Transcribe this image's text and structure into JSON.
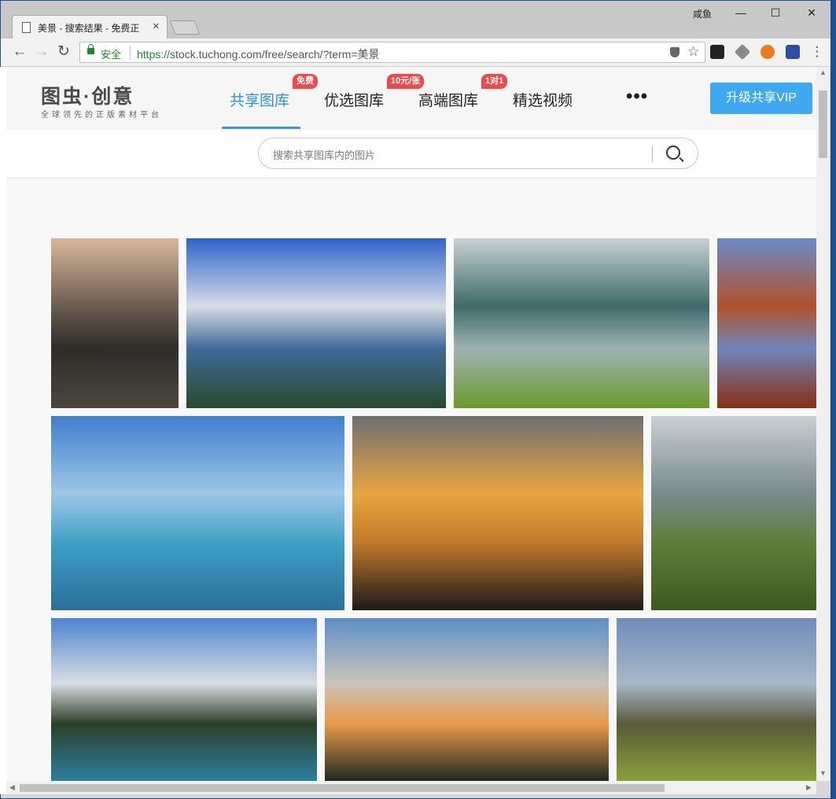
{
  "browser": {
    "tab_title": "美景 - 搜索结果 - 免费正",
    "tab_close": "×",
    "user": "咸鱼",
    "window_controls": {
      "minimize": "—",
      "maximize": "☐",
      "close": "✕"
    },
    "nav": {
      "back": "←",
      "forward": "→",
      "reload": "↻"
    },
    "secure_label": "安全",
    "url_protocol": "https://",
    "url_rest": "stock.tuchong.com/free/search/?term=美景",
    "star": "☆",
    "menu": "⋮"
  },
  "site": {
    "logo_mark": "图虫·创意",
    "logo_tagline": "全球领先的正版素材平台",
    "nav_items": [
      {
        "label": "共享图库",
        "badge": "免费",
        "active": true
      },
      {
        "label": "优选图库",
        "badge": "10元/张",
        "active": false
      },
      {
        "label": "高端图库",
        "badge": "1对1",
        "active": false
      },
      {
        "label": "精选视频",
        "badge": "",
        "active": false
      }
    ],
    "more": "•••",
    "vip_button": "升级共享VIP"
  },
  "search": {
    "placeholder": "搜索共享图库内的图片"
  },
  "results": {
    "images": [
      {
        "name": "sunset-lake-karst",
        "colors": [
          "#d9b79a",
          "#6b5d52",
          "#2f2c29",
          "#4b4640"
        ]
      },
      {
        "name": "mountain-clouds",
        "colors": [
          "#2f63c9",
          "#d6dce6",
          "#3f6a9a",
          "#284a2c"
        ]
      },
      {
        "name": "lake-shore-grass",
        "colors": [
          "#c8d2d4",
          "#3e6a6a",
          "#9fb3b3",
          "#6a9a2a"
        ]
      },
      {
        "name": "autumn-tree-reflection",
        "colors": [
          "#6a8cc8",
          "#b0522a",
          "#6f86b8",
          "#8a2e15"
        ]
      },
      {
        "name": "pier-blue-sea",
        "colors": [
          "#3f7fcf",
          "#9ec7e6",
          "#3fa0c6",
          "#2a6f9a"
        ]
      },
      {
        "name": "sunset-silhouette-trees",
        "colors": [
          "#6f6f72",
          "#e8a53f",
          "#c27a2c",
          "#1c1a19"
        ]
      },
      {
        "name": "yurt-grassland",
        "colors": [
          "#c9d0d3",
          "#7a8a8c",
          "#5f7e3a",
          "#3d5a20"
        ]
      },
      {
        "name": "alpine-lake-forest",
        "colors": [
          "#4c84d0",
          "#d8dde2",
          "#2c3f27",
          "#2b7fa0"
        ]
      },
      {
        "name": "pagoda-sunset",
        "colors": [
          "#5d8ec8",
          "#c9c4b8",
          "#e89a4a",
          "#1f2a1c"
        ]
      },
      {
        "name": "rocky-highland",
        "colors": [
          "#6f8cb8",
          "#a9b7c8",
          "#5a5a3a",
          "#8aa03a"
        ]
      }
    ]
  }
}
